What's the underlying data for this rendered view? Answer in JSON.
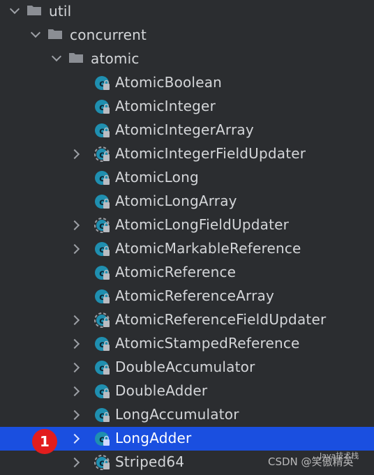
{
  "tree": {
    "folders": [
      {
        "label": "util"
      },
      {
        "label": "concurrent"
      },
      {
        "label": "atomic"
      }
    ],
    "classes": [
      {
        "label": "AtomicBoolean",
        "expandable": false,
        "selected": false
      },
      {
        "label": "AtomicInteger",
        "expandable": false,
        "selected": false
      },
      {
        "label": "AtomicIntegerArray",
        "expandable": false,
        "selected": false
      },
      {
        "label": "AtomicIntegerFieldUpdater",
        "expandable": true,
        "selected": false,
        "abstract": true
      },
      {
        "label": "AtomicLong",
        "expandable": false,
        "selected": false
      },
      {
        "label": "AtomicLongArray",
        "expandable": false,
        "selected": false
      },
      {
        "label": "AtomicLongFieldUpdater",
        "expandable": true,
        "selected": false,
        "abstract": true
      },
      {
        "label": "AtomicMarkableReference",
        "expandable": true,
        "selected": false
      },
      {
        "label": "AtomicReference",
        "expandable": false,
        "selected": false
      },
      {
        "label": "AtomicReferenceArray",
        "expandable": false,
        "selected": false
      },
      {
        "label": "AtomicReferenceFieldUpdater",
        "expandable": true,
        "selected": false,
        "abstract": true
      },
      {
        "label": "AtomicStampedReference",
        "expandable": true,
        "selected": false
      },
      {
        "label": "DoubleAccumulator",
        "expandable": true,
        "selected": false
      },
      {
        "label": "DoubleAdder",
        "expandable": true,
        "selected": false
      },
      {
        "label": "LongAccumulator",
        "expandable": true,
        "selected": false
      },
      {
        "label": "LongAdder",
        "expandable": true,
        "selected": true
      },
      {
        "label": "Striped64",
        "expandable": true,
        "selected": false,
        "abstract": true
      }
    ]
  },
  "annotation": {
    "number": "1"
  },
  "watermark": {
    "main": "CSDN @笑傲精英",
    "small": "Java技术栈"
  },
  "colors": {
    "background": "#2b2d30",
    "selection": "#1a4fe0",
    "class_icon": "#1f8fb0",
    "badge": "#e21d1d"
  }
}
